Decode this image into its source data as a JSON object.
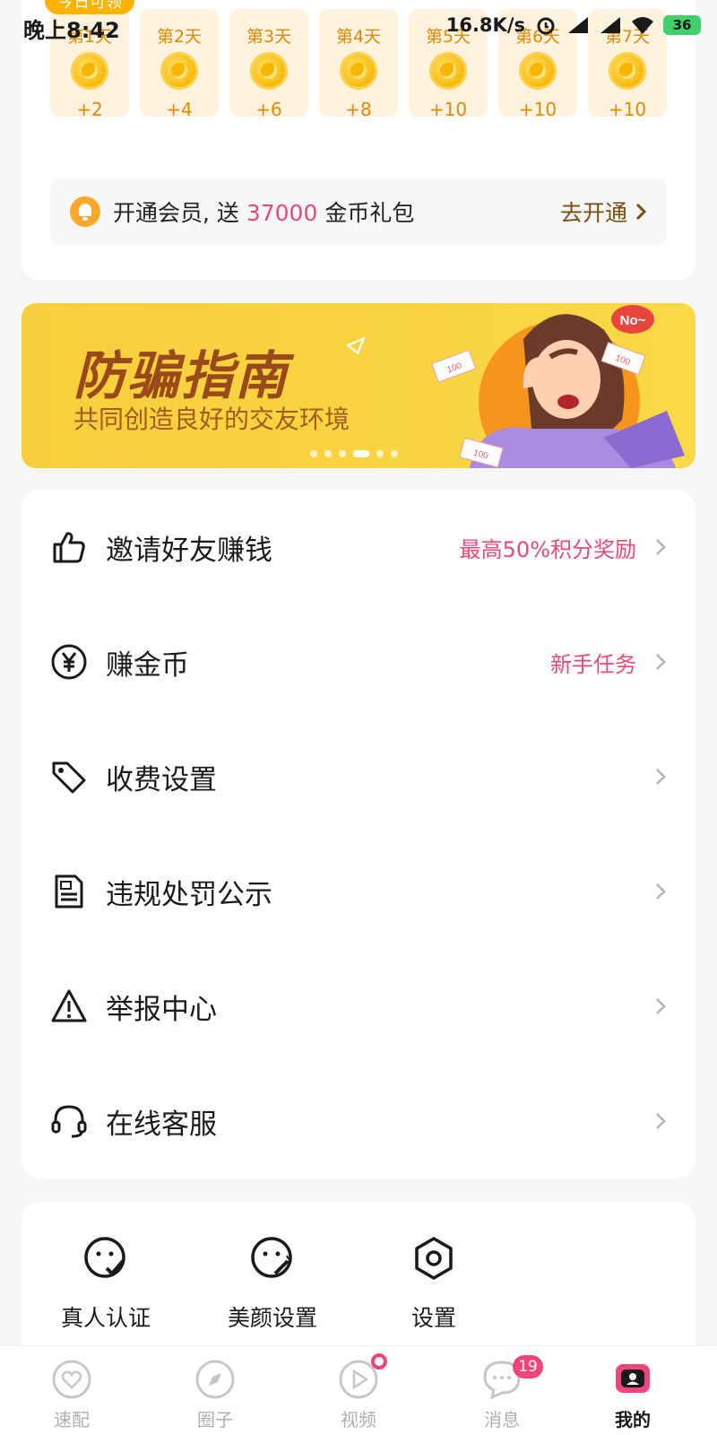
{
  "status_bar": {
    "time": "晚上8:42",
    "net_speed": "16.8K/s",
    "battery": "36",
    "today_pill": "今日可领"
  },
  "checkin": {
    "days": [
      {
        "label": "第1天",
        "reward": "+2"
      },
      {
        "label": "第2天",
        "reward": "+4"
      },
      {
        "label": "第3天",
        "reward": "+6"
      },
      {
        "label": "第4天",
        "reward": "+8"
      },
      {
        "label": "第5天",
        "reward": "+10"
      },
      {
        "label": "第6天",
        "reward": "+10"
      },
      {
        "label": "第7天",
        "reward": "+10"
      }
    ],
    "vip": {
      "text_before": "开通会员, 送 ",
      "amount": "37000",
      "text_after": " 金币礼包",
      "action": "去开通"
    }
  },
  "banner": {
    "title": "防骗指南",
    "subtitle": "共同创造良好的交友环境",
    "bubble": "No~",
    "money": "100",
    "dot_count": 6,
    "active_dot": 3
  },
  "menu": {
    "items": [
      {
        "label": "邀请好友赚钱",
        "hint": "最高50%积分奖励",
        "icon": "thumbs-up-icon"
      },
      {
        "label": "赚金币",
        "hint": "新手任务",
        "icon": "yen-coin-icon"
      },
      {
        "label": "收费设置",
        "hint": "",
        "icon": "price-tag-icon"
      },
      {
        "label": "违规处罚公示",
        "hint": "",
        "icon": "penalty-document-icon"
      },
      {
        "label": "举报中心",
        "hint": "",
        "icon": "warning-triangle-icon"
      },
      {
        "label": "在线客服",
        "hint": "",
        "icon": "headset-icon"
      }
    ]
  },
  "tools": [
    {
      "label": "真人认证",
      "icon": "verified-face-icon"
    },
    {
      "label": "美颜设置",
      "icon": "beauty-face-icon"
    },
    {
      "label": "设置",
      "icon": "hexagon-settings-icon"
    }
  ],
  "tabbar": {
    "tabs": [
      {
        "label": "速配",
        "icon": "heart-icon"
      },
      {
        "label": "圈子",
        "icon": "compass-icon"
      },
      {
        "label": "视频",
        "icon": "play-icon"
      },
      {
        "label": "消息",
        "icon": "chat-icon",
        "badge": "19"
      },
      {
        "label": "我的",
        "icon": "profile-card-icon"
      }
    ]
  },
  "colors": {
    "accent_pink": "#e84a78",
    "gold": "#e08a00",
    "banner_yellow": "#f7cf3c"
  }
}
